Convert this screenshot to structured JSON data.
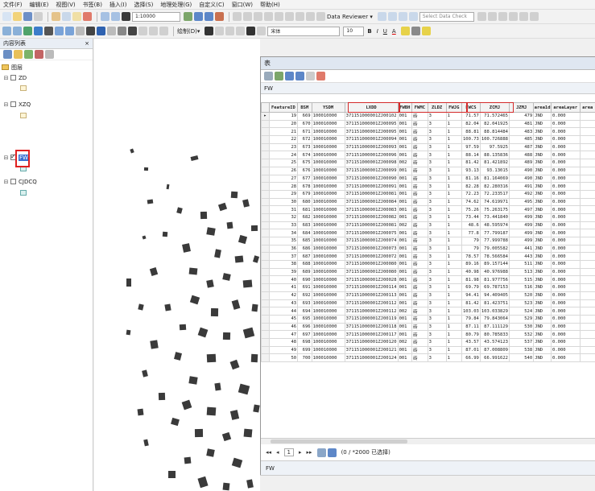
{
  "menu": [
    "文件(F)",
    "编辑(E)",
    "视图(V)",
    "书签(B)",
    "插入(I)",
    "选择(S)",
    "地理处理(G)",
    "自定义(C)",
    "窗口(W)",
    "帮助(H)"
  ],
  "toolbar": {
    "data_reviewer": "Data Reviewer ▾",
    "select_data_check": "Select Data Check",
    "scale": "1:10000",
    "draw_label": "绘制(D)▾",
    "font_name": "宋体",
    "font_size": "10",
    "bold": "B",
    "italic": "I",
    "underline": "U",
    "font_color": "A"
  },
  "toc": {
    "title": "内容列表",
    "close": "⨯",
    "pin": "ᵖ",
    "root": "图层",
    "layers": [
      {
        "name": "ZD",
        "checked": false
      },
      {
        "name": "XZQ",
        "checked": false
      },
      {
        "name": "FW",
        "checked": true
      },
      {
        "name": "CJDCQ",
        "checked": false
      }
    ]
  },
  "attr": {
    "window_title": "表",
    "table_name": "FW",
    "bottom_tab": "FW",
    "columns": [
      "FeatureID",
      "BSM",
      "YSDM",
      "LXDD",
      "FWBH",
      "FWMC",
      "ZLDZ",
      "FWJG",
      "FWCS",
      "ZCMJ",
      "JZMJ",
      "area1d",
      "areaLayer",
      "area"
    ],
    "rows": [
      [
        "19",
        "669",
        "100010000",
        "371151000001ZJ00102",
        "001",
        "砖",
        "3",
        "1",
        "71.57",
        "71.572465",
        "479",
        "JND",
        "0.000"
      ],
      [
        "20",
        "670",
        "100010000",
        "371151000001ZJ00095",
        "001",
        "砖",
        "3",
        "1",
        "82.04",
        "82.041925",
        "481",
        "JND",
        "0.000"
      ],
      [
        "21",
        "671",
        "100010000",
        "371151000001ZJ00095",
        "001",
        "砖",
        "3",
        "1",
        "88.81",
        "88.814484",
        "483",
        "JND",
        "0.000"
      ],
      [
        "22",
        "672",
        "100010000",
        "371151000001ZJ00094",
        "001",
        "砖",
        "3",
        "1",
        "100.73",
        "100.726888",
        "485",
        "JND",
        "0.000"
      ],
      [
        "23",
        "673",
        "100010000",
        "371151000001ZJ00093",
        "001",
        "砖",
        "3",
        "1",
        "97.59",
        "97.5925",
        "487",
        "JND",
        "0.000"
      ],
      [
        "24",
        "674",
        "100010000",
        "371151000001ZJ00096",
        "001",
        "砖",
        "3",
        "1",
        "88.14",
        "88.135836",
        "488",
        "JND",
        "0.000"
      ],
      [
        "25",
        "675",
        "100010000",
        "371151000001ZJ00098",
        "002",
        "砖",
        "3",
        "1",
        "81.42",
        "81.421892",
        "489",
        "JND",
        "0.000"
      ],
      [
        "26",
        "676",
        "100010000",
        "371151000001ZJ00099",
        "001",
        "砖",
        "3",
        "1",
        "93.13",
        "93.13015",
        "490",
        "JND",
        "0.000"
      ],
      [
        "27",
        "677",
        "100010000",
        "371151000001ZJ00090",
        "001",
        "砖",
        "3",
        "1",
        "81.16",
        "81.164069",
        "490",
        "JND",
        "0.000"
      ],
      [
        "28",
        "678",
        "100010000",
        "371151000001ZJ00091",
        "001",
        "砖",
        "3",
        "1",
        "82.28",
        "82.280316",
        "491",
        "JND",
        "0.000"
      ],
      [
        "29",
        "679",
        "100010000",
        "371151000001ZJ00081",
        "001",
        "砖",
        "3",
        "1",
        "72.23",
        "72.233517",
        "492",
        "JND",
        "0.000"
      ],
      [
        "30",
        "680",
        "100010000",
        "371151000001ZJ00084",
        "001",
        "砖",
        "3",
        "1",
        "74.62",
        "74.619971",
        "495",
        "JND",
        "0.000"
      ],
      [
        "31",
        "681",
        "100010000",
        "371151000001ZJ00083",
        "001",
        "砖",
        "3",
        "1",
        "75.26",
        "75.263175",
        "497",
        "JND",
        "0.000"
      ],
      [
        "32",
        "682",
        "100010000",
        "371151000001ZJ00082",
        "001",
        "砖",
        "3",
        "1",
        "73.44",
        "73.441840",
        "499",
        "JND",
        "0.000"
      ],
      [
        "33",
        "683",
        "100010000",
        "371151000001ZJ00081",
        "002",
        "砖",
        "3",
        "1",
        "48.6",
        "48.595974",
        "499",
        "JND",
        "0.000"
      ],
      [
        "34",
        "684",
        "100010000",
        "371151000001ZJ00075",
        "001",
        "砖",
        "3",
        "1",
        "77.8",
        "77.799187",
        "499",
        "JND",
        "0.000"
      ],
      [
        "35",
        "685",
        "100010000",
        "371151000001ZJ00074",
        "001",
        "砖",
        "3",
        "1",
        "79",
        "77.999788",
        "499",
        "JND",
        "0.000"
      ],
      [
        "36",
        "686",
        "100010000",
        "371151000001ZJ00073",
        "001",
        "砖",
        "3",
        "1",
        "79",
        "79.005582",
        "441",
        "JND",
        "0.000"
      ],
      [
        "37",
        "687",
        "100010000",
        "371151000001ZJ00072",
        "001",
        "砖",
        "3",
        "1",
        "78.57",
        "78.566584",
        "443",
        "JND",
        "0.000"
      ],
      [
        "38",
        "688",
        "100010000",
        "371151000001ZJ00080",
        "001",
        "砖",
        "3",
        "1",
        "89.16",
        "89.157144",
        "511",
        "JND",
        "0.000"
      ],
      [
        "39",
        "689",
        "100010000",
        "371151000001ZJ00080",
        "001",
        "砖",
        "3",
        "1",
        "40.98",
        "40.976988",
        "513",
        "JND",
        "0.000"
      ],
      [
        "40",
        "690",
        "100010000",
        "371151000001ZJ00028",
        "001",
        "砖",
        "3",
        "1",
        "81.98",
        "81.977756",
        "515",
        "JND",
        "0.000"
      ],
      [
        "41",
        "691",
        "100010000",
        "371151000001ZJ00114",
        "001",
        "砖",
        "3",
        "1",
        "69.79",
        "69.787153",
        "516",
        "JND",
        "0.000"
      ],
      [
        "42",
        "692",
        "100010000",
        "371151000001ZJ00113",
        "001",
        "砖",
        "3",
        "1",
        "94.41",
        "94.409405",
        "520",
        "JND",
        "0.000"
      ],
      [
        "43",
        "693",
        "100010000",
        "371151000001ZJ00112",
        "001",
        "砖",
        "3",
        "1",
        "81.42",
        "81.423751",
        "523",
        "JND",
        "0.000"
      ],
      [
        "44",
        "694",
        "100010000",
        "371151000001ZJ00112",
        "002",
        "砖",
        "3",
        "1",
        "103.03",
        "103.033829",
        "524",
        "JND",
        "0.000"
      ],
      [
        "45",
        "695",
        "100010000",
        "371151000001ZJ00119",
        "001",
        "砖",
        "3",
        "1",
        "79.84",
        "79.843064",
        "529",
        "JND",
        "0.000"
      ],
      [
        "46",
        "696",
        "100010000",
        "371151000001ZJ00118",
        "001",
        "砖",
        "3",
        "1",
        "87.11",
        "87.111129",
        "530",
        "JND",
        "0.000"
      ],
      [
        "47",
        "697",
        "100010000",
        "371151000001ZJ00117",
        "001",
        "砖",
        "3",
        "1",
        "80.79",
        "80.785833",
        "532",
        "JND",
        "0.000"
      ],
      [
        "48",
        "698",
        "100010000",
        "371151000001ZJ00120",
        "002",
        "砖",
        "3",
        "1",
        "43.57",
        "43.574123",
        "537",
        "JND",
        "0.000"
      ],
      [
        "49",
        "699",
        "100010000",
        "371151000001ZJ00121",
        "001",
        "砖",
        "3",
        "1",
        "87.01",
        "87.008809",
        "538",
        "JND",
        "0.000"
      ],
      [
        "50",
        "700",
        "100010000",
        "371151000001ZJ00124",
        "001",
        "砖",
        "3",
        "1",
        "66.99",
        "66.991622",
        "540",
        "JND",
        "0.000"
      ]
    ],
    "nav": {
      "first": "◂◂",
      "prev": "◂",
      "current": "1",
      "next": "▸",
      "last": "▸▸",
      "status": "(0 / *2000 已选择)"
    }
  }
}
